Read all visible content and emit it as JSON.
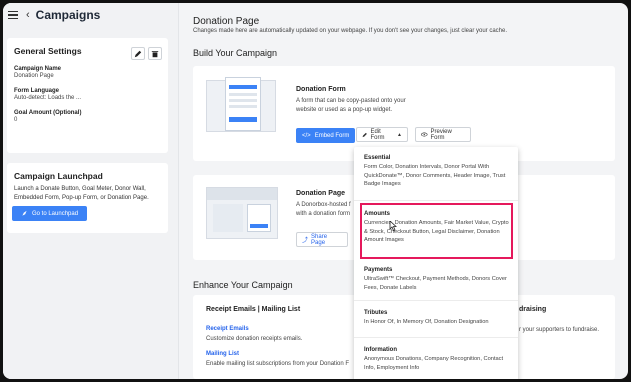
{
  "header": {
    "title": "Campaigns"
  },
  "general_settings": {
    "title": "General Settings",
    "fields": [
      {
        "label": "Campaign Name",
        "value": "Donation Page"
      },
      {
        "label": "Form Language",
        "value": "Auto-detect: Loads the ..."
      },
      {
        "label": "Goal Amount (Optional)",
        "value": "0"
      }
    ]
  },
  "launchpad": {
    "title": "Campaign Launchpad",
    "description": "Launch a Donate Button, Goal Meter, Donor Wall, Embedded Form, Pop-up Form, or Donation Page.",
    "button_label": "Go to Launchpad"
  },
  "main": {
    "title": "Donation Page",
    "subtitle": "Changes made here are automatically updated on your webpage. If you don't see your changes, just clear your cache.",
    "build_section": "Build Your Campaign",
    "donation_form": {
      "title": "Donation Form",
      "description": "A form that can be copy-pasted onto your website or used as a pop-up widget.",
      "embed_label": "Embed Form",
      "edit_label": "Edit Form",
      "preview_label": "Preview Form"
    },
    "donation_page": {
      "title": "Donation Page",
      "description_line1": "A Donorbox-hosted f",
      "description_line2": "with a donation form",
      "share_label": "Share Page"
    },
    "enhance_section": "Enhance Your Campaign",
    "enhance": {
      "card_title": "Receipt Emails | Mailing List",
      "receipt_link": "Receipt Emails",
      "receipt_desc": "Customize donation receipts emails.",
      "mailing_link": "Mailing List",
      "mailing_desc": "Enable mailing list subscriptions from your Donation F",
      "right_title": "draising",
      "right_desc": "r your supporters to fundraise."
    }
  },
  "dropdown": {
    "sections": [
      {
        "heading": "Essential",
        "items": "Form Color, Donation Intervals, Donor Portal With QuickDonate™, Donor Comments, Header Image, Trust Badge Images"
      },
      {
        "heading": "Amounts",
        "items": "Currencies, Donation Amounts, Fair Market Value, Crypto & Stock, Checkout Button, Legal Disclaimer, Donation Amount Images"
      },
      {
        "heading": "Payments",
        "items": "UltraSwift™ Checkout, Payment Methods, Donors Cover Fees, Donate Labels"
      },
      {
        "heading": "Tributes",
        "items": "In Honor Of, In Memory Of, Donation Designation"
      },
      {
        "heading": "Information",
        "items": "Anonymous Donations, Company Recognition, Contact Info, Employment Info"
      }
    ]
  },
  "colors": {
    "accent": "#3b82f6",
    "highlight": "#e5195c"
  }
}
